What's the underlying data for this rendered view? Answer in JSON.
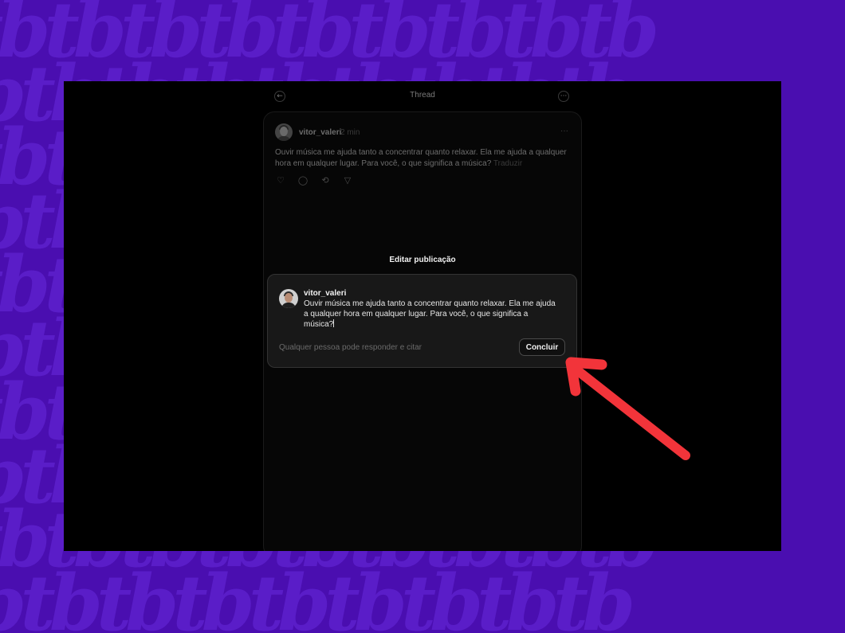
{
  "topbar": {
    "title": "Thread",
    "back_icon": "arrow-left-icon",
    "more_icon": "more-horizontal-icon",
    "back_glyph": "←",
    "more_glyph": "···"
  },
  "post": {
    "username": "vitor_valeri",
    "time": "2 min",
    "more_glyph": "···",
    "text": "Ouvir música me ajuda tanto a concentrar quanto relaxar. Ela me ajuda a qualquer hora em qualquer lugar. Para você, o que significa a música?",
    "translate_label": "Traduzir",
    "actions": [
      {
        "icon": "heart-icon",
        "glyph": "♡"
      },
      {
        "icon": "comment-icon",
        "glyph": "◯"
      },
      {
        "icon": "repost-icon",
        "glyph": "⟲"
      },
      {
        "icon": "share-icon",
        "glyph": "▽"
      }
    ]
  },
  "edit_modal": {
    "title": "Editar publicação",
    "username": "vitor_valeri",
    "text": "Ouvir música me ajuda tanto a concentrar quanto relaxar. Ela me ajuda a qualquer hora em qualquer lugar. Para você, o que significa a música?",
    "reply_setting": "Qualquer pessoa pode responder e citar",
    "done_label": "Concluir"
  },
  "background": {
    "watermark_text": "tbtbtbtbtbtbtbtbtb"
  },
  "colors": {
    "background": "#4a0eb0",
    "screen": "#000000",
    "modal": "#181818",
    "arrow": "#f2343a"
  }
}
